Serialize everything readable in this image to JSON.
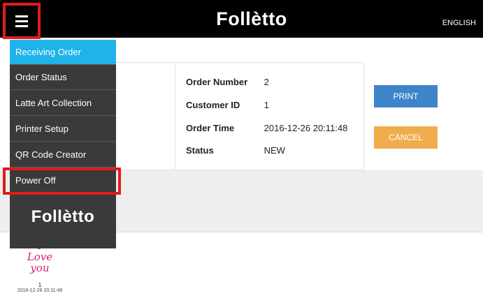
{
  "header": {
    "brand": "Follètto",
    "language": "ENGLISH",
    "menu_icon": "hamburger-icon"
  },
  "sidebar": {
    "items": [
      {
        "label": "Receiving Order",
        "active": true
      },
      {
        "label": "Order Status",
        "active": false
      },
      {
        "label": "Latte Art Collection",
        "active": false
      },
      {
        "label": "Printer Setup",
        "active": false
      },
      {
        "label": "QR Code Creator",
        "active": false
      },
      {
        "label": "Power Off",
        "active": false
      }
    ],
    "brand": "Follètto"
  },
  "order": {
    "number_label": "Order Number",
    "number_value": "2",
    "customer_label": "Customer ID",
    "customer_value": "1",
    "time_label": "Order Time",
    "time_value": "2016-12-26 20:11:48",
    "status_label": "Status",
    "status_value": "NEW"
  },
  "actions": {
    "print_label": "PRINT",
    "cancel_label": "CANCEL"
  },
  "gallery": {
    "items": [
      {
        "art_line1": "I",
        "art_line2": "Love",
        "art_line3": "you",
        "count": "1",
        "date": "2016-12-26 20:11:48"
      }
    ]
  },
  "colors": {
    "topbar": "#000000",
    "menu_bg": "#3a3a3a",
    "menu_active": "#1fb3ea",
    "highlight": "#e21b1b",
    "print": "#3d85c8",
    "cancel": "#f0ad4e"
  }
}
